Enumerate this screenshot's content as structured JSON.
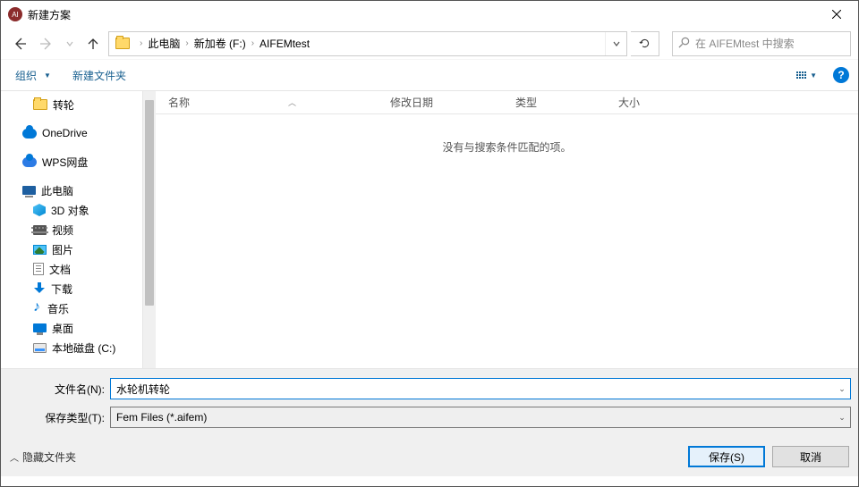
{
  "title": "新建方案",
  "breadcrumb": {
    "pc": "此电脑",
    "vol": "新加卷 (F:)",
    "folder": "AIFEMtest"
  },
  "search_placeholder": "在 AIFEMtest 中搜索",
  "toolbar": {
    "organize": "组织",
    "newfolder": "新建文件夹"
  },
  "columns": {
    "name": "名称",
    "date": "修改日期",
    "type": "类型",
    "size": "大小"
  },
  "empty": "没有与搜索条件匹配的项。",
  "tree": {
    "zhuanlun": "转轮",
    "onedrive": "OneDrive",
    "wps": "WPS网盘",
    "thispc": "此电脑",
    "obj3d": "3D 对象",
    "video": "视频",
    "pics": "图片",
    "docs": "文档",
    "downloads": "下载",
    "music": "音乐",
    "desktop": "桌面",
    "diskc": "本地磁盘 (C:)"
  },
  "filename_label": "文件名(N):",
  "filetype_label": "保存类型(T):",
  "filename_value": "水轮机转轮",
  "filetype_value": "Fem Files (*.aifem)",
  "hide_folders": "隐藏文件夹",
  "save_btn": "保存(S)",
  "cancel_btn": "取消"
}
